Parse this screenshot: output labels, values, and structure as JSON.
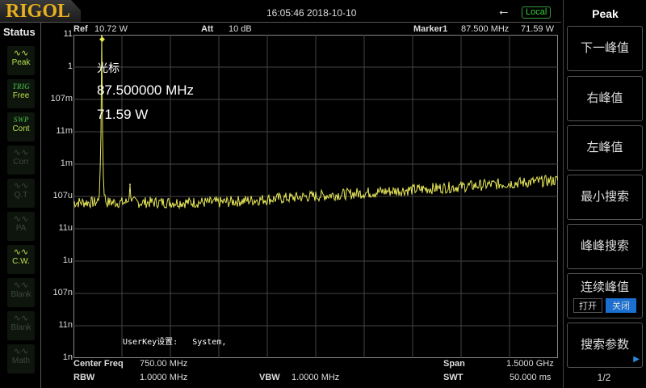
{
  "header": {
    "brand": "RIGOL",
    "datetime": "16:05:46 2018-10-10",
    "usb_icon": "usb-icon",
    "remote_status": "Local"
  },
  "status": {
    "title": "Status",
    "buttons": [
      {
        "top": "Peak",
        "icon": "peak-icon",
        "active": true
      },
      {
        "top": "TRIG",
        "label": "Free",
        "active": true
      },
      {
        "top": "SWP",
        "label": "Cont",
        "active": true
      },
      {
        "label": "Corr",
        "icon": "corr-icon",
        "active": false
      },
      {
        "label": "Q.T",
        "icon": "qt-icon",
        "active": false
      },
      {
        "label": "PA",
        "icon": "pa-icon",
        "active": false
      },
      {
        "label": "C.W.",
        "icon": "cw-icon",
        "active": true
      },
      {
        "label": "Blank",
        "icon": "wave-icon",
        "active": false
      },
      {
        "label": "Blank",
        "icon": "wave-icon",
        "active": false
      },
      {
        "label": "Math",
        "icon": "math-icon",
        "active": false
      }
    ]
  },
  "measure": {
    "ref_label": "Ref",
    "ref_value": "10.72 W",
    "att_label": "Att",
    "att_value": "10 dB",
    "marker_label": "Marker1",
    "marker_freq": "87.500 MHz",
    "marker_value": "71.59 W"
  },
  "marker_box": {
    "title": "光标",
    "freq": "87.500000 MHz",
    "value": "71.59 W"
  },
  "userkey": "UserKey设置:   System,",
  "footer": {
    "center_label": "Center Freq",
    "center_value": "750.00 MHz",
    "span_label": "Span",
    "span_value": "1.5000 GHz",
    "rbw_label": "RBW",
    "rbw_value": "1.0000 MHz",
    "vbw_label": "VBW",
    "vbw_value": "1.0000 MHz",
    "swt_label": "SWT",
    "swt_value": "50.000 ms"
  },
  "menu": {
    "title": "Peak",
    "items": [
      "下一峰值",
      "右峰值",
      "左峰值",
      "最小搜索",
      "峰峰搜索"
    ],
    "continuous": {
      "label": "连续峰值",
      "on": "打开",
      "off": "关闭"
    },
    "search_params": "搜索参数",
    "page": "1/2"
  },
  "chart_data": {
    "type": "line",
    "x_unit": "MHz",
    "xlim": [
      0,
      1500
    ],
    "y_scale": "log",
    "y_ticks": [
      "11",
      "1",
      "107m",
      "11m",
      "1m",
      "107u",
      "11u",
      "1u",
      "107n",
      "11n",
      "1n"
    ],
    "ylim_W": [
      1.072e-09,
      10.72
    ],
    "series": [
      {
        "name": "trace",
        "noise_floor_start_W": 7e-05,
        "noise_floor_end_W": 0.00034,
        "peaks": [
          {
            "x": 87.5,
            "y": 71.59
          },
          {
            "x": 175,
            "y": 0.00025
          }
        ]
      }
    ]
  },
  "colors": {
    "trace": "#e8e85a",
    "accent": "#1a6fd0",
    "logo": "#e8b01c"
  }
}
